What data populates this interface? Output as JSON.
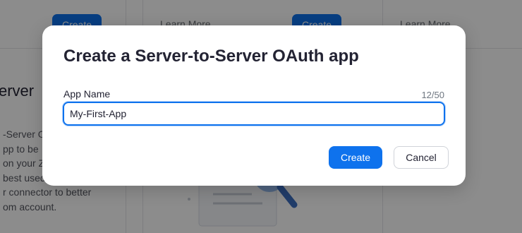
{
  "background": {
    "cards": [
      {
        "create_label": "Create",
        "learn_more_label": "Learn More"
      },
      {
        "create_label": "Create",
        "learn_more_label": "Learn More"
      }
    ],
    "section_title_fragment": "erver",
    "description_lines": [
      "-Server O",
      "pp to be",
      "on your Z",
      "best used",
      "r connector to better",
      "om account."
    ]
  },
  "modal": {
    "title": "Create a Server-to-Server OAuth app",
    "field_label": "App Name",
    "char_count": "12/50",
    "input_value": "My-First-App",
    "create_label": "Create",
    "cancel_label": "Cancel"
  },
  "colors": {
    "primary": "#0e72ed",
    "text": "#232333"
  }
}
